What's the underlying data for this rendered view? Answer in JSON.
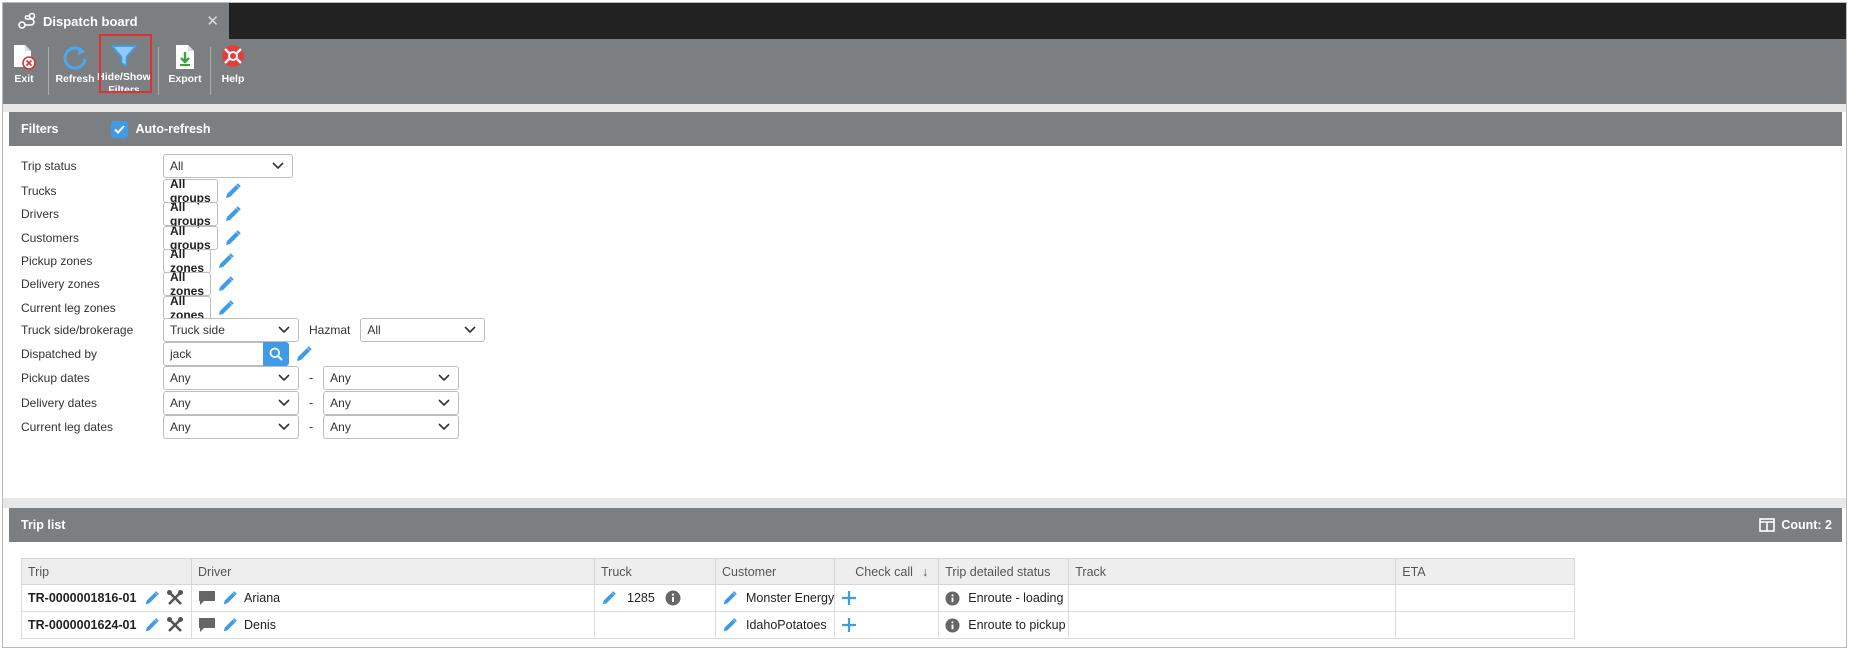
{
  "tab": {
    "title": "Dispatch board",
    "close": "✕"
  },
  "toolbar": {
    "exit": "Exit",
    "refresh": "Refresh",
    "hide_show_1": "Hide/Show",
    "hide_show_2": "Filters",
    "export": "Export",
    "help": "Help"
  },
  "filters": {
    "title": "Filters",
    "auto_refresh": "Auto-refresh",
    "trip_status": {
      "label": "Trip status",
      "value": "All"
    },
    "trucks": {
      "label": "Trucks",
      "value": "All groups"
    },
    "drivers": {
      "label": "Drivers",
      "value": "All groups"
    },
    "customers": {
      "label": "Customers",
      "value": "All groups"
    },
    "pickup_zones": {
      "label": "Pickup zones",
      "value": "All zones"
    },
    "delivery_zones": {
      "label": "Delivery zones",
      "value": "All zones"
    },
    "current_leg_zones": {
      "label": "Current leg zones",
      "value": "All zones"
    },
    "truck_side": {
      "label": "Truck side/brokerage",
      "value": "Truck side"
    },
    "hazmat": {
      "label": "Hazmat",
      "value": "All"
    },
    "dispatched_by": {
      "label": "Dispatched by",
      "value": "jack"
    },
    "pickup_dates": {
      "label": "Pickup dates",
      "from": "Any",
      "to": "Any"
    },
    "delivery_dates": {
      "label": "Delivery dates",
      "from": "Any",
      "to": "Any"
    },
    "current_leg_dates": {
      "label": "Current leg dates",
      "from": "Any",
      "to": "Any"
    },
    "dash": "-"
  },
  "trip_list": {
    "title": "Trip list",
    "count": "Count: 2",
    "columns": [
      "Trip",
      "Driver",
      "Truck",
      "Customer",
      "Check call",
      "Trip detailed status",
      "Track",
      "ETA"
    ],
    "sort_arrow": "↓",
    "rows": [
      {
        "trip": "TR-0000001816-01",
        "driver": "Ariana",
        "truck": "1285",
        "customer": "Monster Energy",
        "status": "Enroute - loading"
      },
      {
        "trip": "TR-0000001624-01",
        "driver": "Denis",
        "truck": "",
        "customer": "IdahoPotatoes",
        "status": "Enroute to pickup"
      }
    ]
  },
  "colors": {
    "accent": "#3f9be8",
    "toolbar": "#7c7f81",
    "highlight": "#e03030"
  }
}
